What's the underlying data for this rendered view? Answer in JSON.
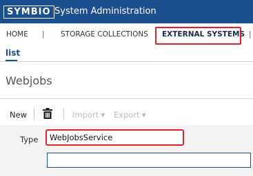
{
  "header": {
    "logo_text": "SYMBIO",
    "title": "System Administration"
  },
  "nav": {
    "home": "HOME",
    "separator": "|",
    "storage": "STORAGE COLLECTIONS",
    "external": "EXTERNAL SYSTEMS"
  },
  "subnav": {
    "active_tab": "list"
  },
  "page": {
    "title": "Webjobs"
  },
  "toolbar": {
    "new_label": "New",
    "delete_icon": "trash-icon",
    "import_label": "Import",
    "export_label": "Export"
  },
  "form": {
    "type_label": "Type",
    "type_value": "WebJobsService",
    "second_value": ""
  },
  "colors": {
    "topbar": "#1b4f8f",
    "highlight": "#e0202a",
    "accent": "#1b4f8f"
  }
}
